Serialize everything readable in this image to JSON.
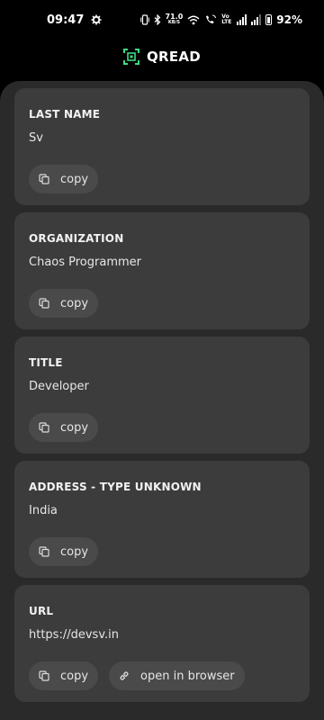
{
  "status_bar": {
    "time": "09:47",
    "speed": "71.0",
    "speed_unit": "KB/S",
    "network": "Vo LTE",
    "battery": "92%"
  },
  "header": {
    "app_name": "QREAD",
    "logo_icon": "qr-scan-icon",
    "accent_color": "#3ddc84"
  },
  "cards": [
    {
      "title": "LAST NAME",
      "value": "Sv",
      "actions": [
        {
          "label": "copy",
          "icon": "copy-icon"
        }
      ]
    },
    {
      "title": "ORGANIZATION",
      "value": "Chaos Programmer",
      "actions": [
        {
          "label": "copy",
          "icon": "copy-icon"
        }
      ]
    },
    {
      "title": "TITLE",
      "value": "Developer",
      "actions": [
        {
          "label": "copy",
          "icon": "copy-icon"
        }
      ]
    },
    {
      "title": "ADDRESS - TYPE UNKNOWN",
      "value": "India",
      "actions": [
        {
          "label": "copy",
          "icon": "copy-icon"
        }
      ]
    },
    {
      "title": "URL",
      "value": "https://devsv.in",
      "actions": [
        {
          "label": "copy",
          "icon": "copy-icon"
        },
        {
          "label": "open in browser",
          "icon": "link-icon"
        }
      ]
    }
  ]
}
